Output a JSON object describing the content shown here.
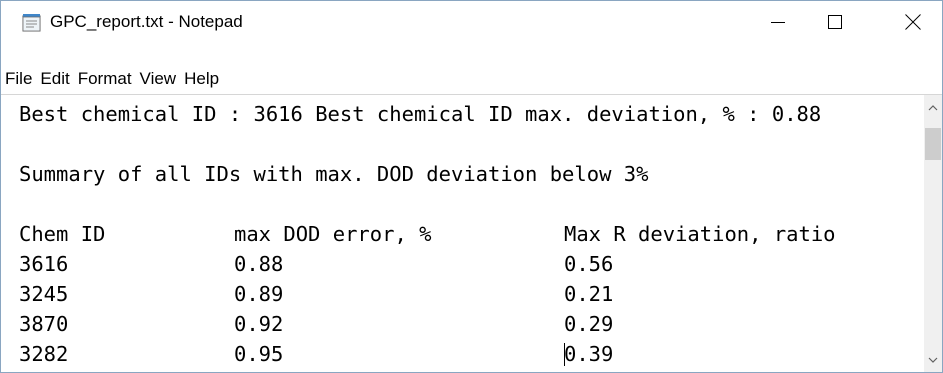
{
  "window": {
    "title": "GPC_report.txt - Notepad"
  },
  "menu": {
    "items": [
      {
        "label": "File"
      },
      {
        "label": "Edit"
      },
      {
        "label": "Format"
      },
      {
        "label": "View"
      },
      {
        "label": "Help"
      }
    ]
  },
  "document": {
    "line1": "Best chemical ID : 3616 Best chemical ID max. deviation, % : 0.88",
    "line2": "",
    "line3": "Summary of all IDs with max. DOD deviation below 3%",
    "line4": "",
    "headers": [
      "Chem ID",
      "max DOD error, %",
      "Max R deviation, ratio"
    ],
    "rows": [
      [
        "3616",
        "0.88",
        "0.56"
      ],
      [
        "3245",
        "0.89",
        "0.21"
      ],
      [
        "3870",
        "0.92",
        "0.29"
      ],
      [
        "3282",
        "0.95",
        "0.39"
      ]
    ]
  },
  "icons": {
    "app": "notepad-icon",
    "minimize": "minimize-icon",
    "maximize": "maximize-icon",
    "close": "close-icon",
    "scroll_up": "scroll-up-arrow-icon",
    "scroll_down": "scroll-down-arrow-icon"
  },
  "colors": {
    "window_border": "#8aa6c1",
    "scrollbar_track": "#f0f0f0",
    "scrollbar_thumb": "#cdcdcd"
  }
}
